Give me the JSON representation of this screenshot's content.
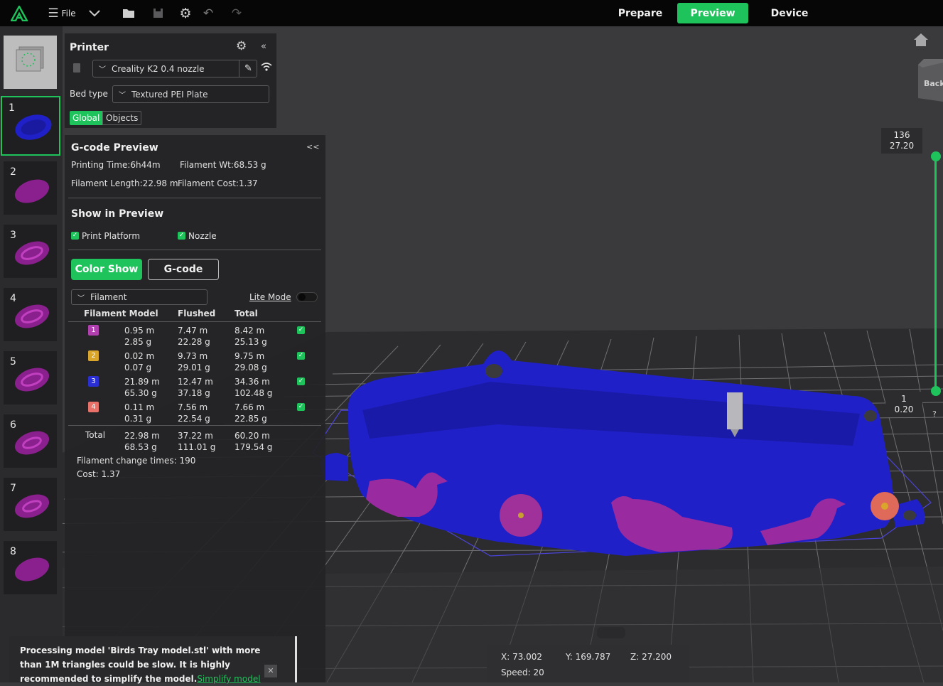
{
  "topbar": {
    "file_label": "File",
    "tabs": [
      "Prepare",
      "Preview",
      "Device"
    ],
    "active_tab": "Preview"
  },
  "plates": [
    {
      "num": ""
    },
    {
      "num": "1"
    },
    {
      "num": "2"
    },
    {
      "num": "3"
    },
    {
      "num": "4"
    },
    {
      "num": "5"
    },
    {
      "num": "6"
    },
    {
      "num": "7"
    },
    {
      "num": "8"
    }
  ],
  "printer": {
    "title": "Printer",
    "collapse": "«",
    "model": "Creality K2 0.4 nozzle",
    "bed_label": "Bed type",
    "bed_value": "Textured PEI Plate",
    "seg_global": "Global",
    "seg_objects": "Objects"
  },
  "gcode": {
    "title": "G-code Preview",
    "collapse": "<<",
    "printing_time": "Printing Time:6h44m",
    "filament_wt": "Filament Wt:68.53 g",
    "filament_length": "Filament Length:22.98 m",
    "filament_cost": "Filament Cost:1.37",
    "show_title": "Show in Preview",
    "print_platform": "Print Platform",
    "nozzle": "Nozzle",
    "color_show": "Color Show",
    "gcode_btn": "G-code",
    "view_select": "Filament",
    "lite_mode": "Lite Mode",
    "col_model": "Filament Model",
    "col_flushed": "Flushed",
    "col_total": "Total",
    "rows": [
      {
        "id": "1",
        "color": "#b23fb0",
        "model_m": "0.95 m",
        "model_g": "2.85 g",
        "flushed_m": "7.47 m",
        "flushed_g": "22.28 g",
        "total_m": "8.42 m",
        "total_g": "25.13 g"
      },
      {
        "id": "2",
        "color": "#d9a52a",
        "model_m": "0.02 m",
        "model_g": "0.07 g",
        "flushed_m": "9.73 m",
        "flushed_g": "29.01 g",
        "total_m": "9.75 m",
        "total_g": "29.08 g"
      },
      {
        "id": "3",
        "color": "#2a2fd4",
        "model_m": "21.89 m",
        "model_g": "65.30 g",
        "flushed_m": "12.47 m",
        "flushed_g": "37.18 g",
        "total_m": "34.36 m",
        "total_g": "102.48 g"
      },
      {
        "id": "4",
        "color": "#e8726a",
        "model_m": "0.11 m",
        "model_g": "0.31 g",
        "flushed_m": "7.56 m",
        "flushed_g": "22.54 g",
        "total_m": "7.66 m",
        "total_g": "22.85 g"
      }
    ],
    "total_label": "Total",
    "total_model_m": "22.98 m",
    "total_model_g": "68.53 g",
    "total_flushed_m": "37.22 m",
    "total_flushed_g": "111.01 g",
    "total_total_m": "60.20 m",
    "total_total_g": "179.54 g",
    "change_times": "Filament change times:  190",
    "cost": "Cost:  1.37"
  },
  "notice": {
    "text": "Processing model 'Birds Tray model.stl' with more than 1M triangles could be slow. It is highly recommended to simplify the model.",
    "link": "Simplify model",
    "close": "✕"
  },
  "coords": {
    "x": "X: 73.002",
    "y": "Y: 169.787",
    "z": "Z: 27.200",
    "speed": "Speed: 20"
  },
  "layers": {
    "top_num": "136",
    "top_height": "27.20",
    "bottom_num": "1",
    "bottom_height": "0.20",
    "help": "?"
  },
  "view_cube": {
    "label": "Back"
  }
}
